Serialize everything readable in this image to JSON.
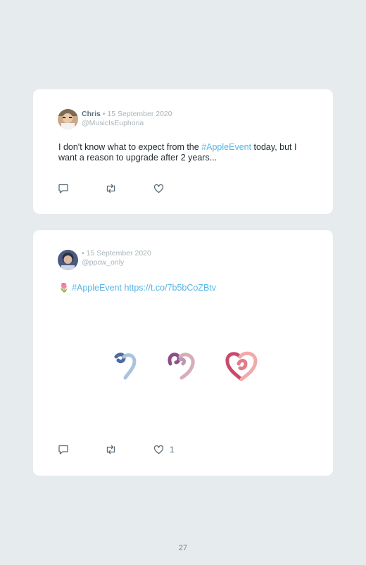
{
  "tweets": [
    {
      "name": "Chris",
      "separator": "•",
      "date": "15 September 2020",
      "handle": "@MusicIsEuphoria",
      "text_before": "I don't know what to expect from the ",
      "hashtag": "#AppleEvent",
      "text_after": " today, but I want a reason to upgrade after 2 years...",
      "avatar_icon": "profile-photo",
      "like_count": ""
    },
    {
      "name": "",
      "separator": "•",
      "date": "15 September 2020",
      "handle": "@ppcw_only",
      "emoji": "🌷",
      "hashtag": "#AppleEvent",
      "url": "https://t.co/7b5bCoZBtv",
      "avatar_icon": "profile-photo",
      "like_count": "1"
    }
  ],
  "icons": {
    "reply": "reply-icon",
    "retweet": "retweet-icon",
    "like": "like-icon"
  },
  "colors": {
    "link": "#58b6e6",
    "background": "#e6ebed",
    "card": "#ffffff"
  },
  "page_number": "27"
}
